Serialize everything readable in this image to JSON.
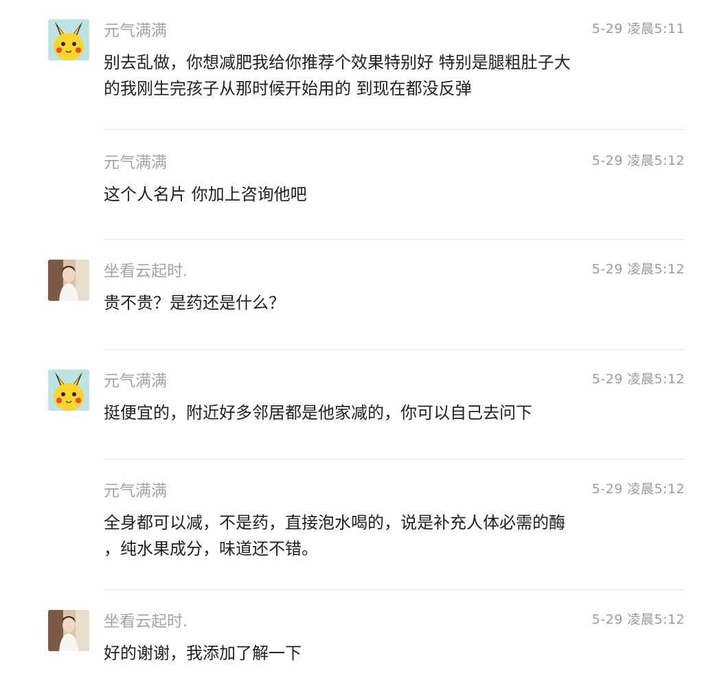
{
  "comments": [
    {
      "username": "元气满满",
      "avatar": "pikachu-avatar",
      "timestamp": "5-29 凌晨5:11",
      "text": "别去乱做，你想减肥我给你推荐个效果特别好 特别是腿粗肚子大\n的我刚生完孩子从那时候开始用的 到现在都没反弹"
    },
    {
      "username": "元气满满",
      "avatar": "",
      "timestamp": "5-29 凌晨5:12",
      "text": "这个人名片 你加上咨询他吧"
    },
    {
      "username": "坐看云起时.",
      "avatar": "photo-avatar",
      "timestamp": "5-29 凌晨5:12",
      "text": "贵不贵？是药还是什么？"
    },
    {
      "username": "元气满满",
      "avatar": "pikachu-avatar",
      "timestamp": "5-29 凌晨5:12",
      "text": "挺便宜的，附近好多邻居都是他家减的，你可以自己去问下"
    },
    {
      "username": "元气满满",
      "avatar": "",
      "timestamp": "5-29 凌晨5:12",
      "text": "全身都可以减，不是药，直接泡水喝的，说是补充人体必需的酶\n，纯水果成分，味道还不错。"
    },
    {
      "username": "坐看云起时.",
      "avatar": "photo-avatar",
      "timestamp": "5-29 凌晨5:12",
      "text": "好的谢谢，我添加了解一下"
    }
  ],
  "colors": {
    "username": "#a3a3a3",
    "timestamp": "#9a9a9a",
    "text": "#1f1f1f",
    "divider": "#e6e6e6"
  }
}
